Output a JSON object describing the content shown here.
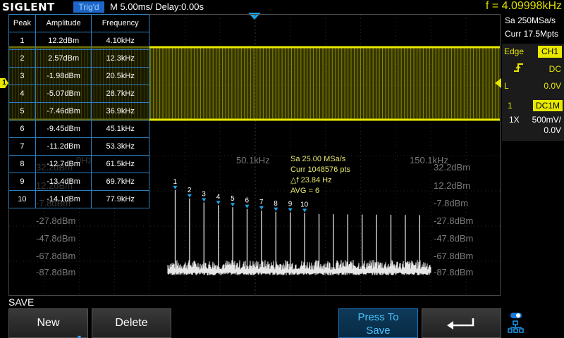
{
  "header": {
    "brand": "SIGLENT",
    "trigger_status": "Trig'd",
    "timebase": "M 5.00ms/ Delay:0.00s",
    "frequency": "f = 4.09998kHz"
  },
  "acquisition": {
    "sample_rate": "Sa 250MSa/s",
    "memory_depth": "Curr 17.5Mpts"
  },
  "trigger": {
    "type": "Edge",
    "source": "CH1",
    "coupling": "DC",
    "level_label": "L",
    "level": "0.0V",
    "slope_icon": "rising-edge-icon"
  },
  "channel": {
    "number": "1",
    "coupling": "DC1M",
    "probe": "1X",
    "scale": "500mV/",
    "offset": "0.0V",
    "marker": "1",
    "color": "#e8e800"
  },
  "peak_table": {
    "headers": [
      "Peak",
      "Amplitude",
      "Frequency"
    ],
    "rows": [
      [
        "1",
        "12.2dBm",
        "4.10kHz"
      ],
      [
        "2",
        "2.57dBm",
        "12.3kHz"
      ],
      [
        "3",
        "-1.98dBm",
        "20.5kHz"
      ],
      [
        "4",
        "-5.07dBm",
        "28.7kHz"
      ],
      [
        "5",
        "-7.46dBm",
        "36.9kHz"
      ],
      [
        "6",
        "-9.45dBm",
        "45.1kHz"
      ],
      [
        "7",
        "-11.2dBm",
        "53.3kHz"
      ],
      [
        "8",
        "-12.7dBm",
        "61.5kHz"
      ],
      [
        "9",
        "-13.4dBm",
        "69.7kHz"
      ],
      [
        "10",
        "-14.1dBm",
        "77.9kHz"
      ]
    ]
  },
  "fft_info": {
    "sample_rate": "Sa 25.00 MSa/s",
    "memory": "Curr 1048576 pts",
    "delta_f": "△f 23.84 Hz",
    "average": "AVG = 6"
  },
  "fft_scale": {
    "freq_labels": [
      "0Hz",
      "50.1kHz",
      "150.1kHz"
    ],
    "db_labels_left": [
      "32.2dBm",
      "12.2dBm",
      "-7.8dBm",
      "-27.8dBm",
      "-47.8dBm",
      "-67.8dBm",
      "-87.8dBm"
    ],
    "db_labels_right": [
      "32.2dBm",
      "12.2dBm",
      "-7.8dBm",
      "-27.8dBm",
      "-47.8dBm",
      "-67.8dBm",
      "-87.8dBm"
    ]
  },
  "menu": {
    "title": "SAVE",
    "new_label": "New",
    "delete_label": "Delete",
    "press_line1": "Press To",
    "press_line2": "Save"
  },
  "colors": {
    "ch1": "#e8e800",
    "fft": "#e6e6e6",
    "accent": "#1aa6e8"
  }
}
